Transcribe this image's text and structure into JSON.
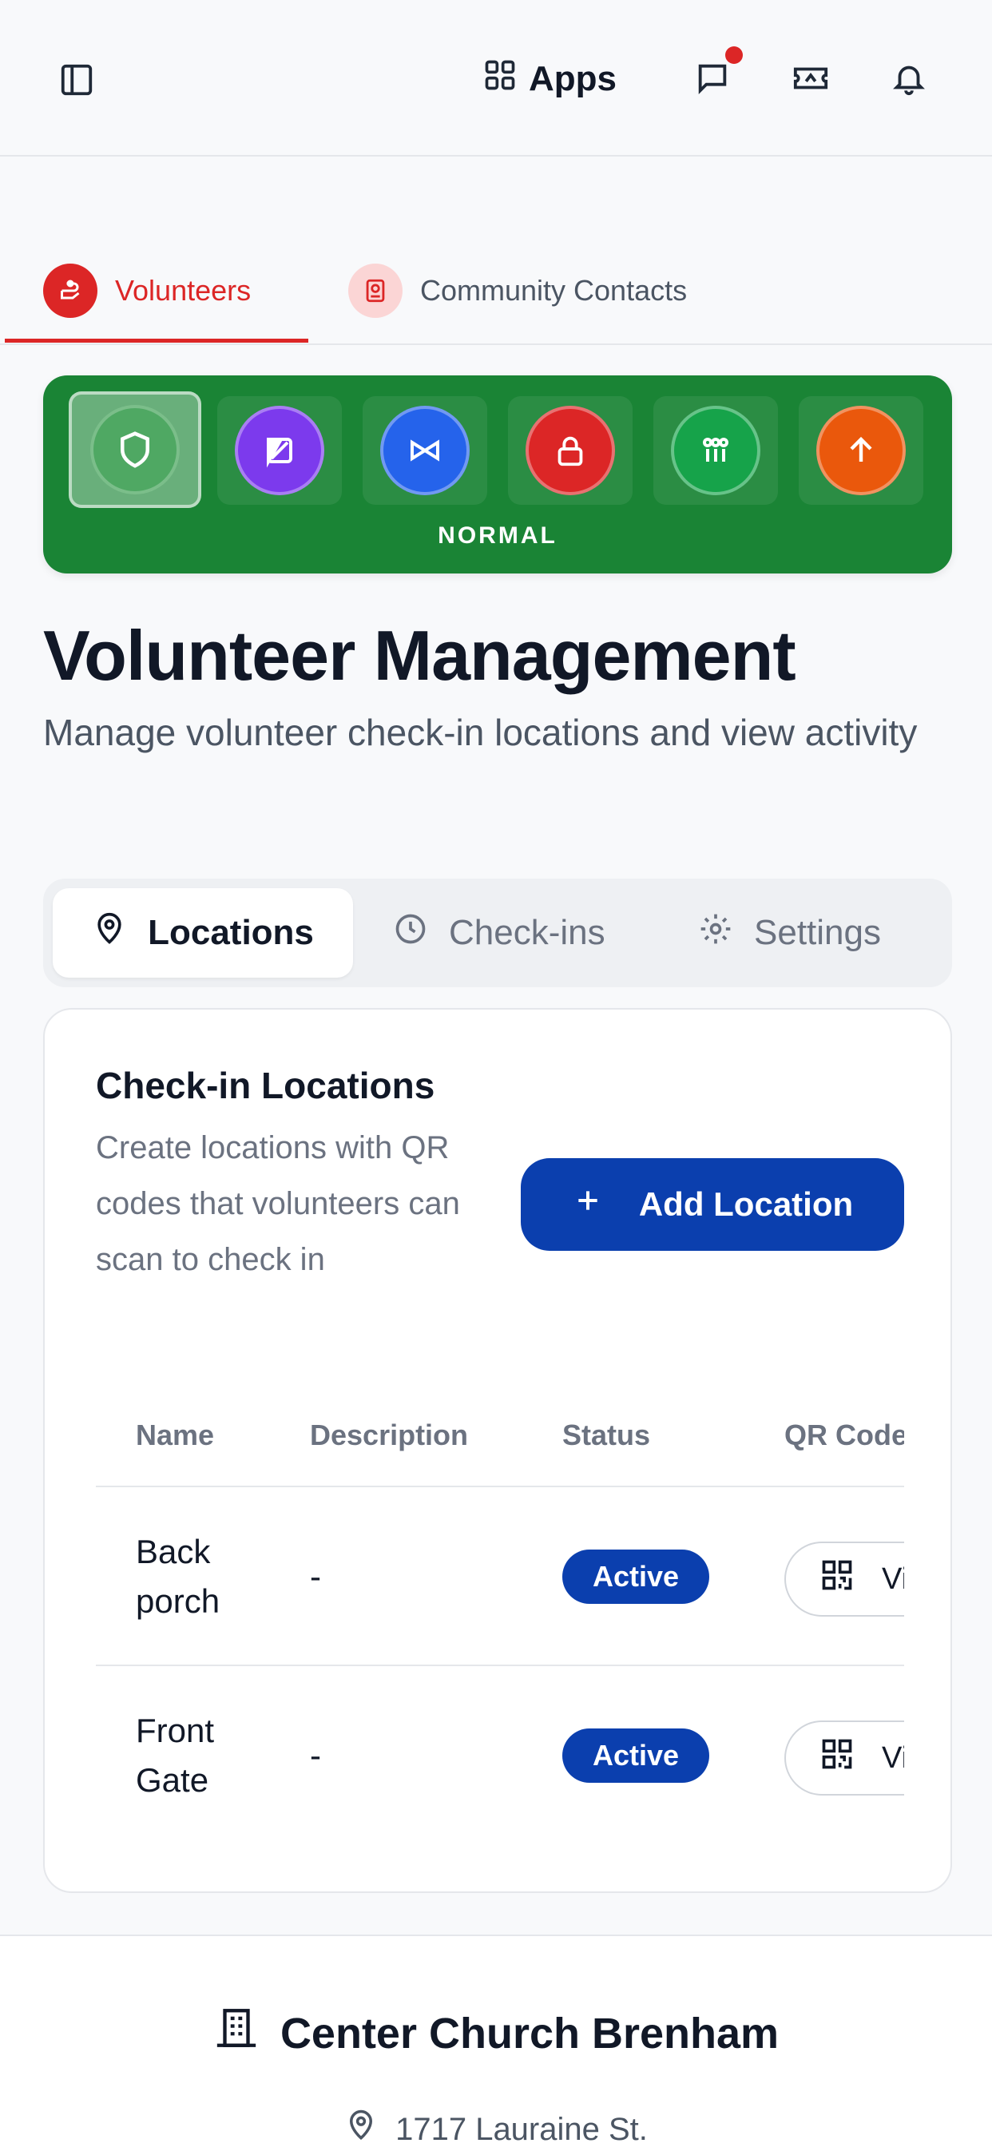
{
  "header": {
    "apps_label": "Apps",
    "icons": [
      "sidebar-toggle-icon",
      "grid-icon",
      "chat-icon",
      "ticket-icon",
      "bell-icon"
    ],
    "notification_color": "#dc2626"
  },
  "nav_tabs": [
    {
      "label": "Volunteers",
      "active": true,
      "icon": "volunteer-hand-icon"
    },
    {
      "label": "Community Contacts",
      "active": false,
      "icon": "contact-badge-icon"
    }
  ],
  "status_banner": {
    "label": "NORMAL",
    "color": "#1a8435",
    "modes": [
      {
        "icon": "shield-icon",
        "color": "#4fa863",
        "selected": true
      },
      {
        "icon": "half-square-icon",
        "color": "#7c3aed",
        "selected": false
      },
      {
        "icon": "bowtie-icon",
        "color": "#2563eb",
        "selected": false
      },
      {
        "icon": "lock-icon",
        "color": "#dc2626",
        "selected": false
      },
      {
        "icon": "people-icon",
        "color": "#16a34a",
        "selected": false
      },
      {
        "icon": "arrow-up-icon",
        "color": "#ea580c",
        "selected": false
      }
    ]
  },
  "page": {
    "title": "Volunteer Management",
    "subtitle": "Manage volunteer check-in locations and view activity"
  },
  "segment_tabs": [
    {
      "label": "Locations",
      "icon": "map-pin-icon",
      "active": true
    },
    {
      "label": "Check-ins",
      "icon": "clock-icon",
      "active": false
    },
    {
      "label": "Settings",
      "icon": "gear-icon",
      "active": false
    }
  ],
  "locations_card": {
    "title": "Check-in Locations",
    "description": "Create locations with QR codes that volunteers can scan to check in",
    "add_button_label": "Add Location",
    "columns": [
      "Name",
      "Description",
      "Status",
      "QR Code"
    ],
    "rows": [
      {
        "name": "Back porch",
        "description": "-",
        "status": "Active",
        "qr_label": "View"
      },
      {
        "name": "Front Gate",
        "description": "-",
        "status": "Active",
        "qr_label": "View"
      }
    ]
  },
  "footer": {
    "org_name": "Center Church Brenham",
    "address": "1717 Lauraine St."
  }
}
